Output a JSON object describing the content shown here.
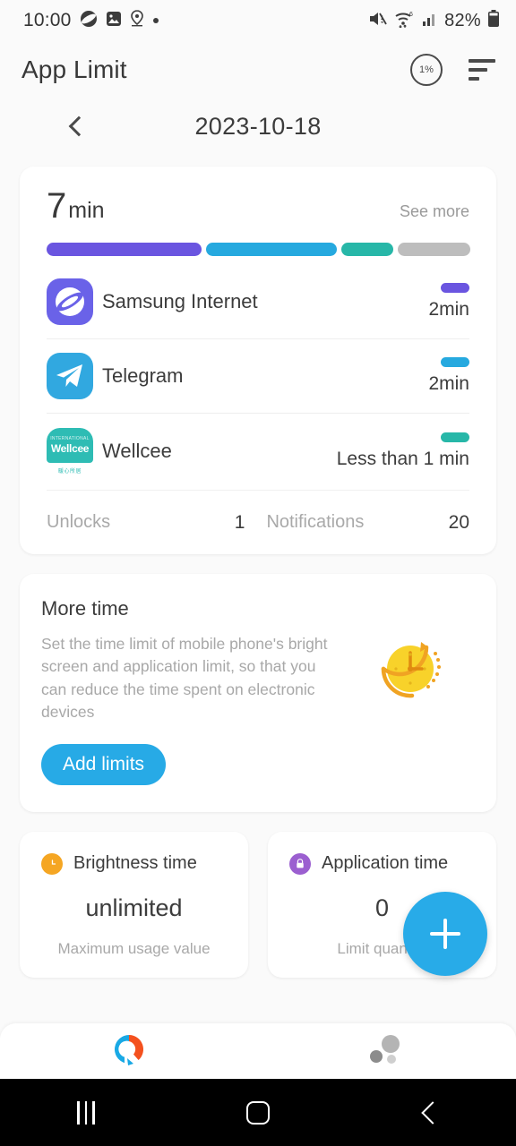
{
  "status_bar": {
    "time": "10:00",
    "battery_percent": "82%",
    "icons": [
      "samsung-internet-icon",
      "gallery-icon",
      "location-icon",
      "dot-icon",
      "mute-icon",
      "wifi-icon",
      "signal-icon",
      "battery-icon"
    ]
  },
  "header": {
    "title": "App Limit",
    "percent_badge": "1%",
    "sort_icon": "sort-icon"
  },
  "date_nav": {
    "prev_label": "previous-day",
    "date": "2023-10-18"
  },
  "usage_card": {
    "total_value": "7",
    "total_unit": "min",
    "see_more": "See more",
    "segments": [
      {
        "name": "Samsung Internet",
        "color": "#6a55e0",
        "width_pct": 36.7
      },
      {
        "name": "Telegram",
        "color": "#26a9df",
        "width_pct": 30.8
      },
      {
        "name": "Wellcee",
        "color": "#27b7a8",
        "width_pct": 12.3
      },
      {
        "name": "Other",
        "color": "#bdbdbd",
        "width_pct": 17.2
      }
    ],
    "apps": [
      {
        "name": "Samsung Internet",
        "duration": "2min",
        "color": "#6a55e0",
        "icon": "samsung-internet-icon"
      },
      {
        "name": "Telegram",
        "duration": "2min",
        "color": "#26a9df",
        "icon": "telegram-icon"
      },
      {
        "name": "Wellcee",
        "duration": "Less than 1 min",
        "color": "#27b7a8",
        "icon": "wellcee-icon",
        "icon_text": {
          "top": "INTERNATIONAL",
          "name": "Wellcee",
          "sub": "暖心所居"
        }
      }
    ],
    "stats": [
      {
        "label": "Unlocks",
        "value": "1"
      },
      {
        "label": "Notifications",
        "value": "20"
      }
    ]
  },
  "more_time_card": {
    "title": "More time",
    "description": "Set the time limit of mobile phone's bright screen and application limit, so that you can reduce the time spent on electronic devices",
    "button_label": "Add limits",
    "illustration": "clock-arrow-icon"
  },
  "small_cards": [
    {
      "title": "Brightness time",
      "value": "unlimited",
      "subtitle": "Maximum usage value",
      "badge_icon": "clock-icon",
      "badge_color": "#f5a623"
    },
    {
      "title": "Application time",
      "value": "0",
      "subtitle": "Limit quantity",
      "badge_icon": "lock-icon",
      "badge_color": "#9b5fd0"
    }
  ],
  "fab": {
    "label": "add-limit",
    "icon": "plus-icon",
    "color": "#28abe8"
  },
  "bottom_nav": [
    {
      "name": "statistics",
      "icon": "donut-chart-icon",
      "active": true
    },
    {
      "name": "bubbles",
      "icon": "bubbles-icon",
      "active": false
    }
  ],
  "android_nav": [
    {
      "name": "recents",
      "icon": "recents-icon"
    },
    {
      "name": "home",
      "icon": "home-icon"
    },
    {
      "name": "back",
      "icon": "back-icon"
    }
  ]
}
